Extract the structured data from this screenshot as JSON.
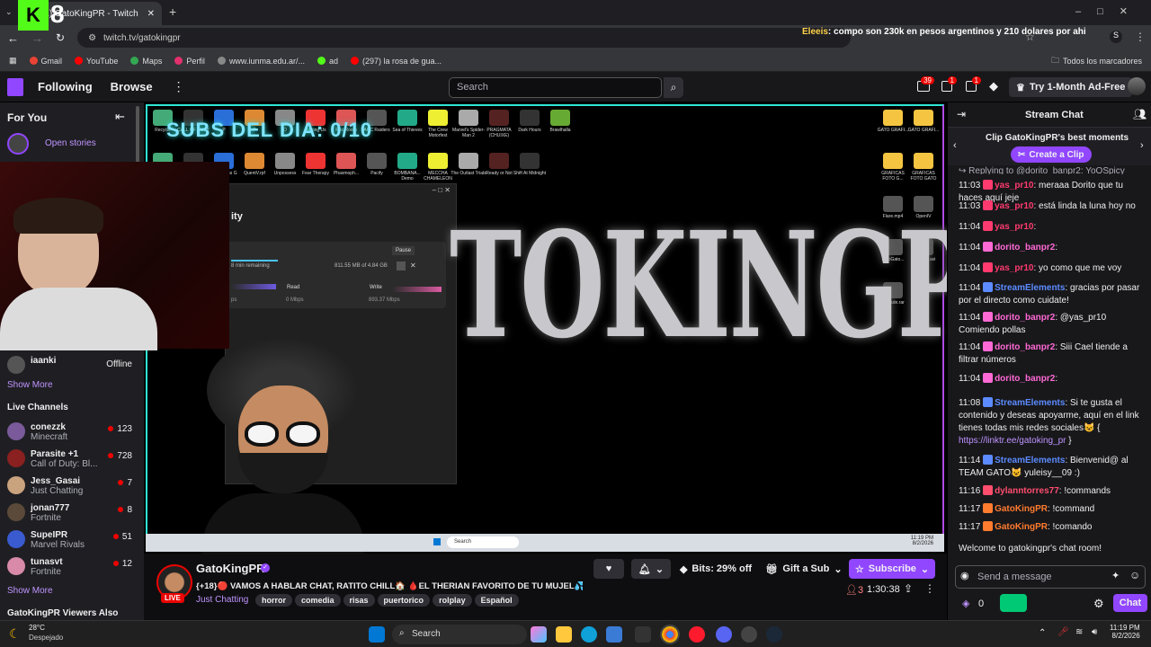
{
  "browser": {
    "tab_title": "(1) GatoKingPR - Twitch",
    "url": "twitch.tv/gatokingpr",
    "overlay_message": {
      "user": "Eleeis",
      "text": ": compo son 230k en pesos argentinos y 210 dolares por ahi"
    },
    "bookmarks": [
      "Gmail",
      "YouTube",
      "Maps",
      "Perfil",
      "www.iunma.edu.ar/...",
      "ad",
      "(297) la rosa de gua..."
    ],
    "bookmarks_folder": "Todos los marcadores"
  },
  "nav": {
    "following": "Following",
    "browse": "Browse",
    "search_placeholder": "Search",
    "badges": {
      "inbox": "39",
      "whispers": "1",
      "notifications": "1"
    },
    "ad_free": "Try 1-Month Ad-Free"
  },
  "sidebar": {
    "for_you": "For You",
    "open_stories": "Open stories",
    "offline_channel": {
      "name": "iaanki",
      "status": "Offline"
    },
    "show_more_1": "Show More",
    "live_channels_title": "Live Channels",
    "channels": [
      {
        "name": "conezzk",
        "game": "Minecraft",
        "viewers": "123",
        "color": "#7a5a9a"
      },
      {
        "name": "Parasite +1",
        "game": "Call of Duty: Bl...",
        "viewers": "728",
        "color": "#8a2020"
      },
      {
        "name": "Jess_Gasai",
        "game": "Just Chatting",
        "viewers": "7",
        "color": "#c9a27e"
      },
      {
        "name": "jonan777",
        "game": "Fortnite",
        "viewers": "8",
        "color": "#5b4a3a"
      },
      {
        "name": "SupeIPR",
        "game": "Marvel Rivals",
        "viewers": "51",
        "color": "#3a5ad0"
      },
      {
        "name": "tunasvt",
        "game": "Fortnite",
        "viewers": "12",
        "color": "#d88aa8"
      }
    ],
    "show_more_2": "Show More",
    "viewers_also": "GatoKingPR Viewers Also"
  },
  "video": {
    "subs_text": "SUBS DEL DIA: 0/10",
    "logo_text": "TOKINGPR",
    "dialog": {
      "title": "ity",
      "time_remaining": "8 min remaining",
      "size": "811.55 MB of 4.84 GB",
      "pause_tooltip": "Pause",
      "read_label": "Read",
      "read_value": "0 Mbps",
      "write_label": "Write",
      "write_value": "893.37 Mbps",
      "left_value": "ps"
    },
    "desktop_icons": [
      "Recycle",
      "CALL OF DUTY",
      "P",
      "P",
      "O",
      "Among Us",
      "Rec Room",
      "ARC Raiders",
      "Sea of Thieves",
      "The Crew Motorfest",
      "Marvel's Spider-Man 2",
      "PRAGMATA (CHUIXE)",
      "Dark Hours",
      "Brawlhalla",
      "Crosshair2",
      "DSX",
      "hellostross G",
      "QuentV.rpf",
      "Unpossess",
      "Fear Therapy",
      "Phasmoph...",
      "Pacify",
      "BOMBANA... Demo",
      "MECCHA CHAMELEON",
      "The Outlast Trials",
      "Ready or Not",
      "Shift At Midnight"
    ],
    "right_icons": [
      "GATO GRAFI...",
      "GATO GRAFI...",
      "GRAFICAS FOTO G...",
      "GRAFICAS FOTO GATO",
      "Flare.mp4",
      "OpenIV",
      "IntroGato...",
      "overlay2.avi",
      "reshade.rar"
    ],
    "inner_taskbar": {
      "search": "Search",
      "time": "11:19 PM",
      "date": "8/2/2026"
    }
  },
  "stream": {
    "channel_name": "GatoKingPR",
    "title": "{+18}🔴 VAMOS A HABLAR CHAT, RATITO CHILL🏠 🩸EL THERIAN FAVORITO DE TU MUJEL💦",
    "category": "Just Chatting",
    "tags": [
      "horror",
      "comedia",
      "risas",
      "puertorico",
      "rolplay",
      "Español"
    ],
    "live_label": "LIVE",
    "bits_label": "Bits: 29% off",
    "gift_label": "Gift a Sub",
    "subscribe_label": "Subscribe",
    "viewer_count": "3",
    "uptime": "1:30:38"
  },
  "chat": {
    "header": "Stream Chat",
    "clip_title": "Clip GatoKingPR's best moments",
    "create_clip": "Create a Clip",
    "reply_line": "Replying to @dorito_banpr2: YoOSpicy",
    "messages": [
      {
        "time": "11:03",
        "user": "yas_pr10",
        "color": "#ff3a6e",
        "text": ": meraaa Dorito que tu haces aquí jeje"
      },
      {
        "time": "11:03",
        "user": "yas_pr10",
        "color": "#ff3a6e",
        "text": ": está linda la luna hoy no"
      },
      {
        "time": "11:04",
        "user": "yas_pr10",
        "color": "#ff3a6e",
        "text": ":"
      },
      {
        "time": "11:04",
        "user": "dorito_banpr2",
        "color": "#ff69d5",
        "text": ":"
      },
      {
        "time": "11:04",
        "user": "yas_pr10",
        "color": "#ff3a6e",
        "text": ": yo como que me voy"
      },
      {
        "time": "11:04",
        "user": "StreamElements",
        "color": "#5c8bff",
        "text": ": gracias por pasar por el directo como cuidate!"
      },
      {
        "time": "11:04",
        "user": "dorito_banpr2",
        "color": "#ff69d5",
        "text": ": @yas_pr10 Comiendo pollas"
      },
      {
        "time": "11:04",
        "user": "dorito_banpr2",
        "color": "#ff69d5",
        "text": ": Siii Cael tiende a filtrar números"
      },
      {
        "time": "11:04",
        "user": "dorito_banpr2",
        "color": "#ff69d5",
        "text": ":"
      },
      {
        "time": "11:08",
        "user": "StreamElements",
        "color": "#5c8bff",
        "text": ": Si te gusta el contenido y deseas apoyarme, aquí en el link tienes todas mis redes sociales😺 {",
        "link": "https://linktr.ee/gatoking_pr",
        "tail": " }"
      },
      {
        "time": "11:14",
        "user": "StreamElements",
        "color": "#5c8bff",
        "text": ": Bienvenid@ al TEAM GATO😺 yuleisy__09 :)"
      },
      {
        "time": "11:16",
        "user": "dylanntorres77",
        "color": "#ff4d6d",
        "text": ": !commands"
      },
      {
        "time": "11:17",
        "user": "GatoKingPR",
        "color": "#ff7b2e",
        "text": ": !command"
      },
      {
        "time": "11:17",
        "user": "GatoKingPR",
        "color": "#ff7b2e",
        "text": ": !comando"
      }
    ],
    "welcome": "Welcome to gatokingpr's chat room!",
    "input_placeholder": "Send a message",
    "points": "0",
    "chat_button": "Chat"
  },
  "taskbar": {
    "weather_temp": "28°C",
    "weather_desc": "Despejado",
    "search": "Search",
    "time": "11:19 PM",
    "date": "8/2/2026"
  }
}
